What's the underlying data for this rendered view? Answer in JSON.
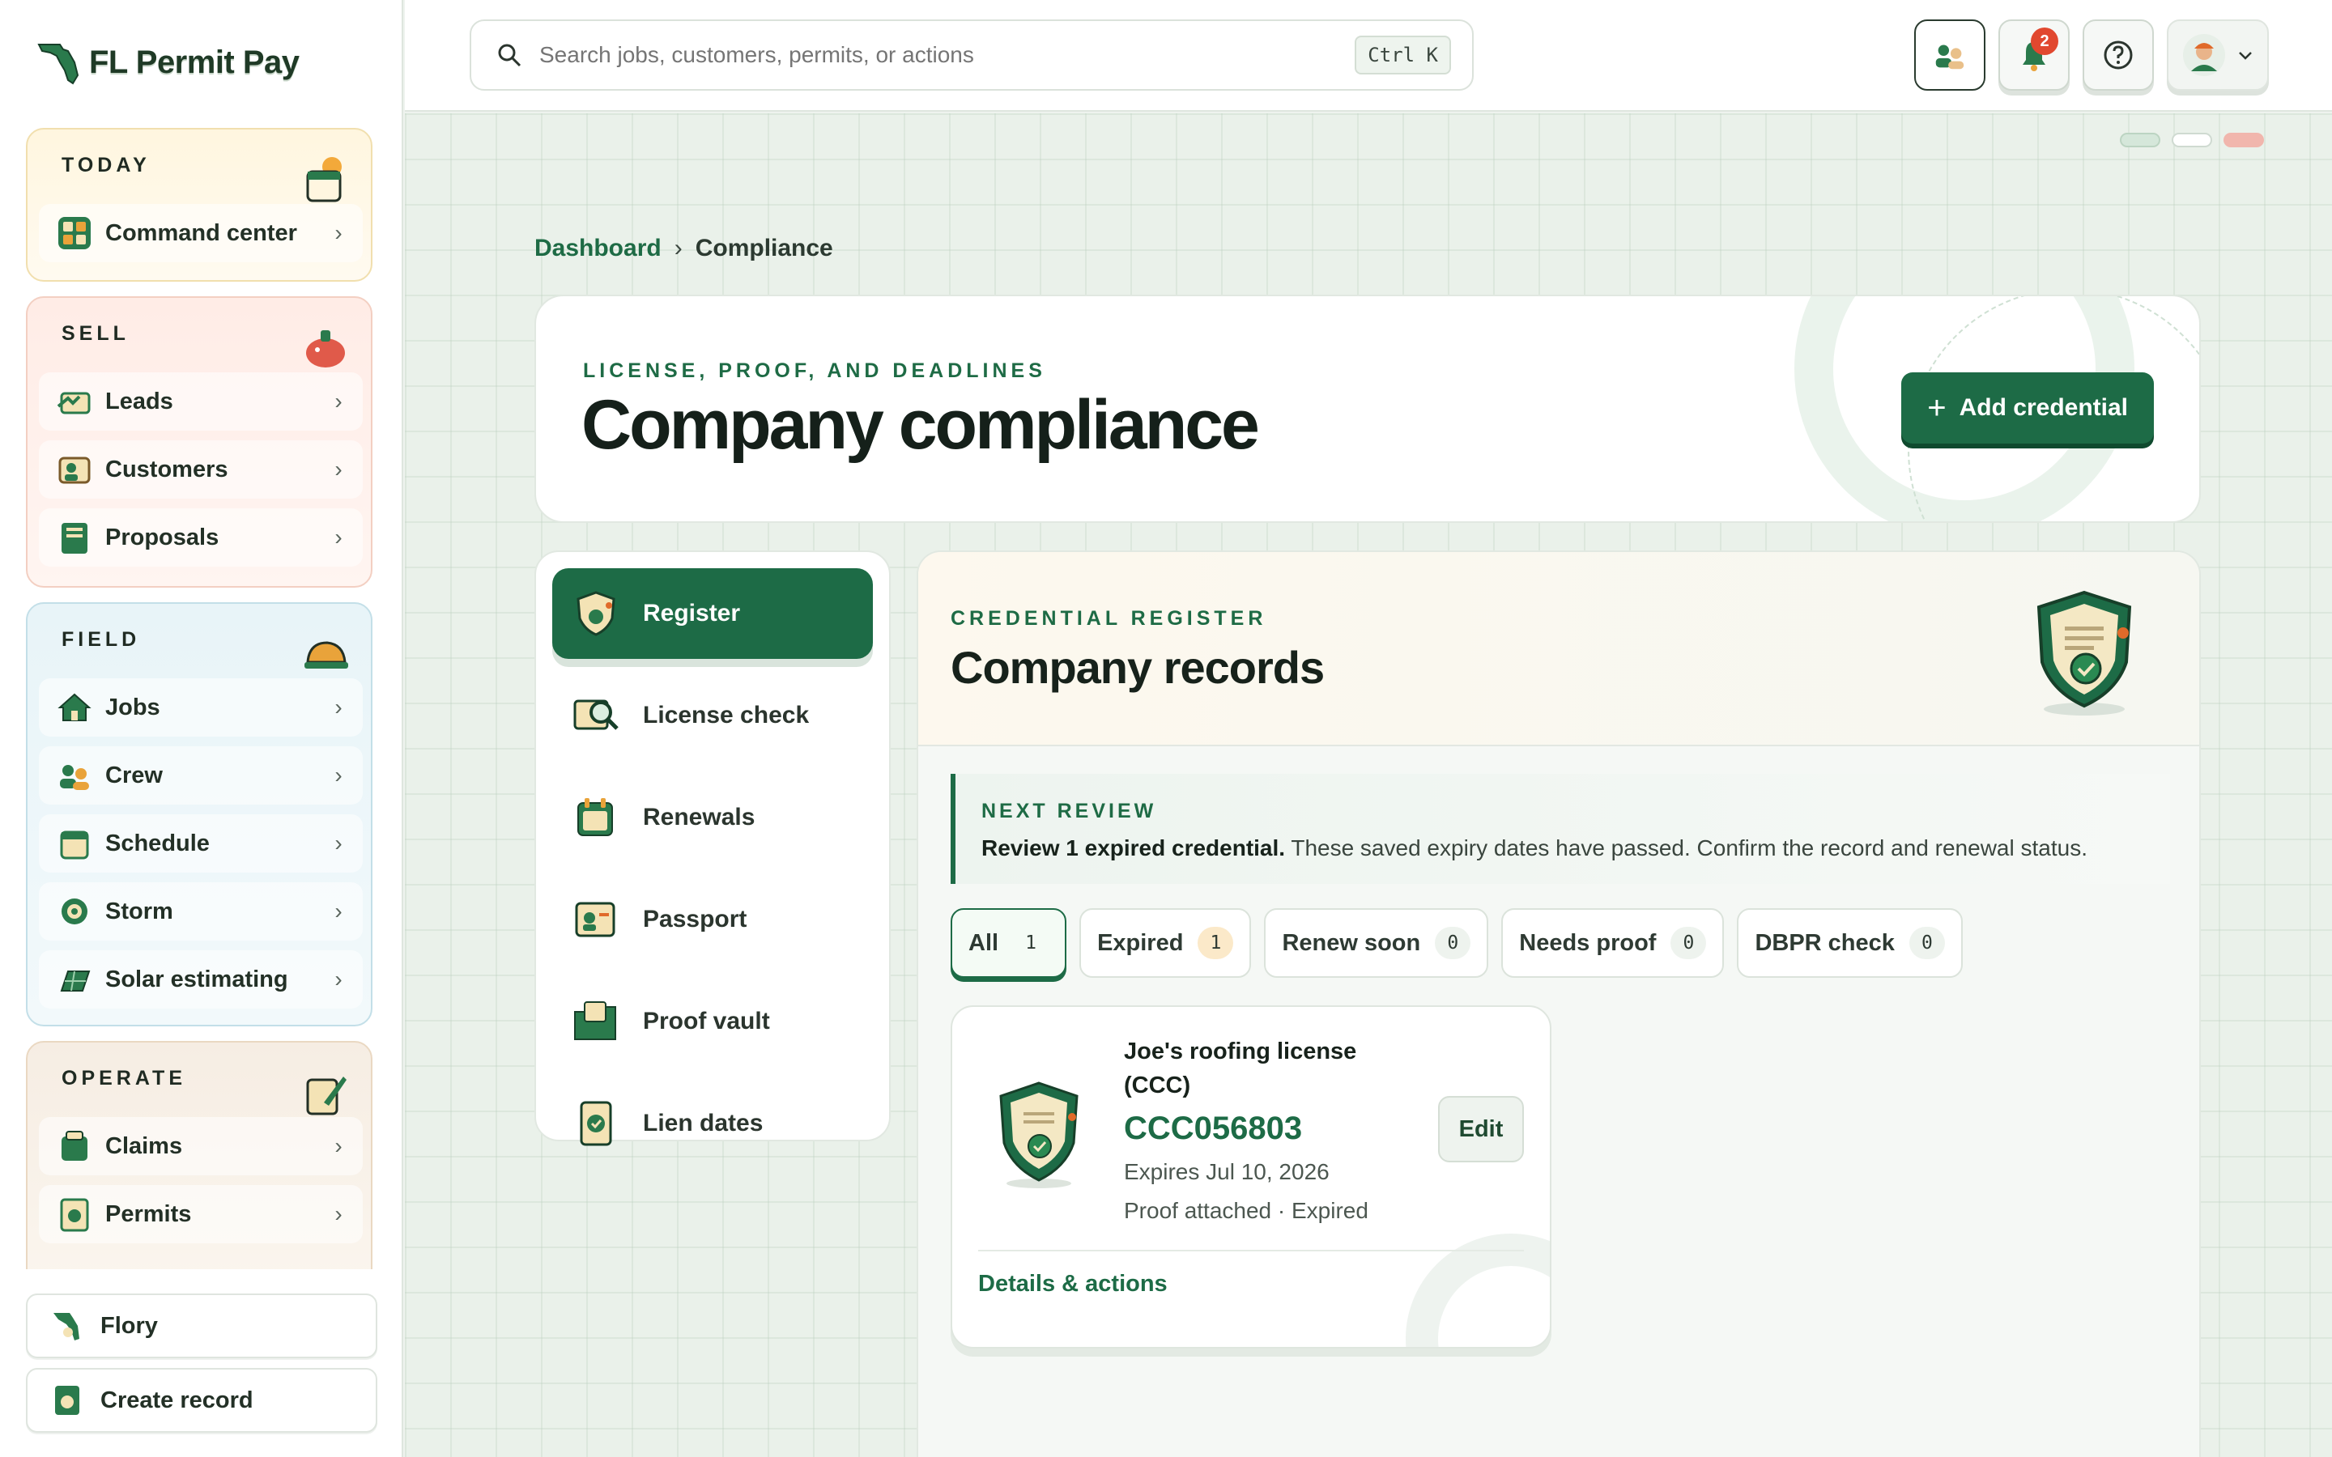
{
  "app": {
    "name": "FL Permit Pay"
  },
  "sidebar": {
    "groups": [
      {
        "label": "TODAY",
        "items": [
          {
            "label": "Command center"
          }
        ]
      },
      {
        "label": "SELL",
        "items": [
          {
            "label": "Leads"
          },
          {
            "label": "Customers"
          },
          {
            "label": "Proposals"
          }
        ]
      },
      {
        "label": "FIELD",
        "items": [
          {
            "label": "Jobs"
          },
          {
            "label": "Crew"
          },
          {
            "label": "Schedule"
          },
          {
            "label": "Storm"
          },
          {
            "label": "Solar estimating"
          }
        ]
      },
      {
        "label": "OPERATE",
        "items": [
          {
            "label": "Claims"
          },
          {
            "label": "Permits"
          }
        ]
      }
    ],
    "footer": {
      "assistant_label": "Flory",
      "create_label": "Create record"
    }
  },
  "topbar": {
    "search": {
      "placeholder": "Search jobs, customers, permits, or actions",
      "shortcut": "Ctrl K"
    },
    "notifications_count": "2",
    "icons": [
      "crew-icon",
      "bell-icon",
      "help-icon",
      "avatar"
    ]
  },
  "breadcrumb": {
    "parent": "Dashboard",
    "separator": "›",
    "current": "Compliance"
  },
  "hero": {
    "eyebrow": "LICENSE, PROOF, AND DEADLINES",
    "title": "Company compliance",
    "action_label": "Add credential"
  },
  "compliance_tabs": [
    {
      "label": "Register",
      "active": true
    },
    {
      "label": "License check"
    },
    {
      "label": "Renewals"
    },
    {
      "label": "Passport"
    },
    {
      "label": "Proof vault"
    },
    {
      "label": "Lien dates"
    }
  ],
  "register": {
    "eyebrow": "CREDENTIAL REGISTER",
    "title": "Company records",
    "next_review": {
      "eyebrow": "NEXT REVIEW",
      "headline": "Review 1 expired credential.",
      "detail": " These saved expiry dates have passed. Confirm the record and renewal status."
    },
    "filters": [
      {
        "label": "All",
        "count": "1",
        "active": true
      },
      {
        "label": "Expired",
        "count": "1"
      },
      {
        "label": "Renew soon",
        "count": "0"
      },
      {
        "label": "Needs proof",
        "count": "0"
      },
      {
        "label": "DBPR check",
        "count": "0"
      }
    ],
    "records": [
      {
        "name": "Joe's roofing license (CCC)",
        "number": "CCC056803",
        "expires": "Expires Jul 10, 2026",
        "status": "Proof attached · Expired",
        "edit_label": "Edit",
        "details_label": "Details & actions"
      }
    ]
  },
  "colors": {
    "brand": "#1d6b46",
    "alert": "#e1482f",
    "warning_chip": "#fbe9c9"
  }
}
